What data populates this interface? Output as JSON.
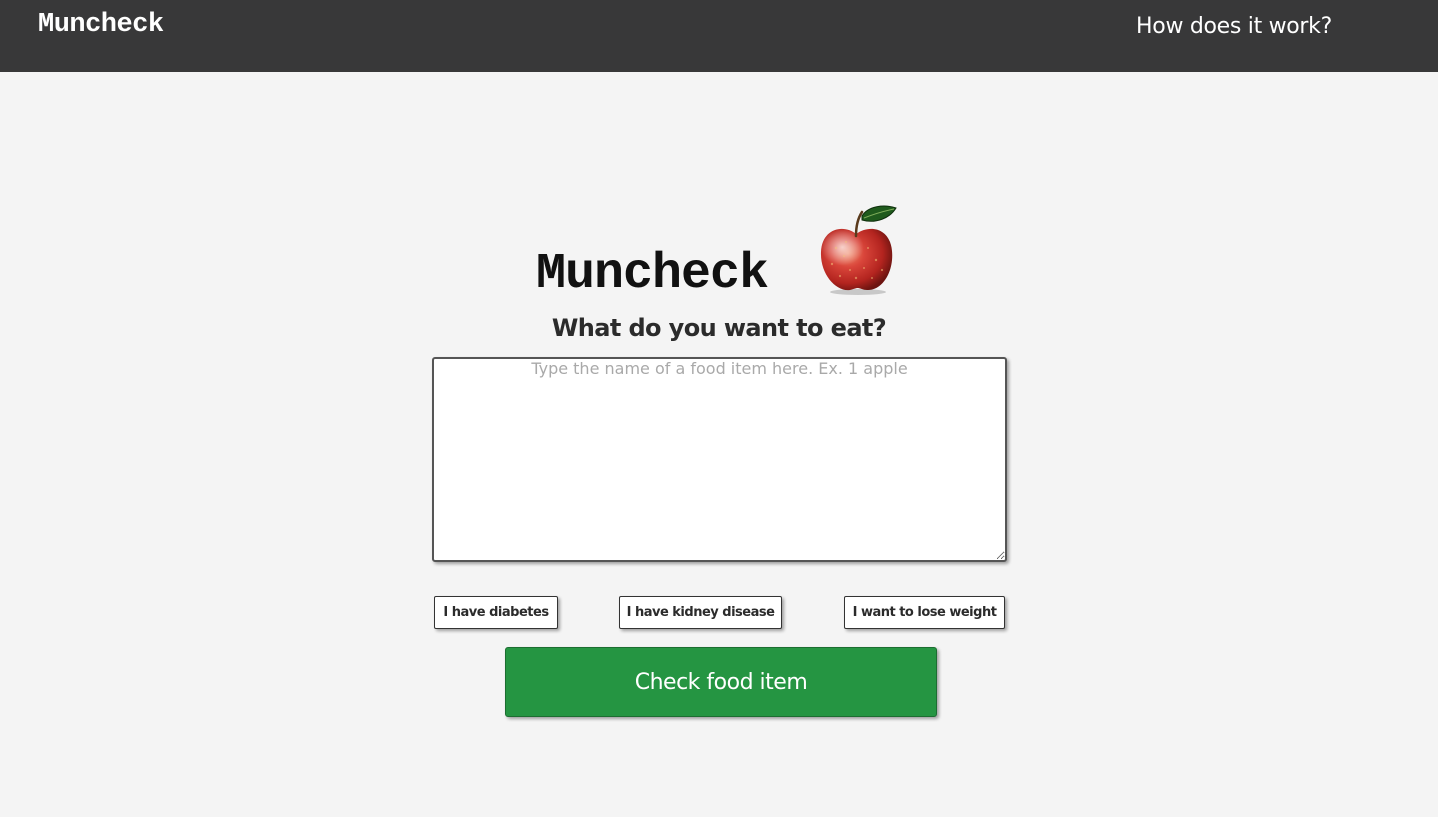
{
  "navbar": {
    "brand": "Muncheck",
    "link": "How does it work?",
    "background": "#383839"
  },
  "hero": {
    "logo_text": "Muncheck",
    "logo_image": "apple-icon",
    "prompt": "What do you want to eat?"
  },
  "search": {
    "value": "",
    "placeholder": "Type the name of a food item here. Ex. 1 apple"
  },
  "conditions": [
    {
      "label": "I have diabetes"
    },
    {
      "label": "I have kidney disease"
    },
    {
      "label": "I want to lose weight"
    }
  ],
  "submit": {
    "label": "Check food item",
    "color": "#259542"
  }
}
